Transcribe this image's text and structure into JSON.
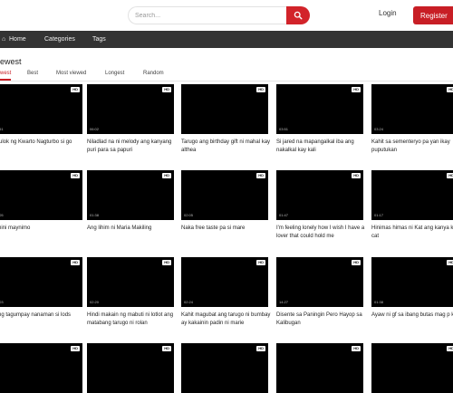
{
  "header": {
    "search_placeholder": "Search...",
    "login_label": "Login",
    "register_label": "Register"
  },
  "nav": {
    "home": "Home",
    "categories": "Categories",
    "tags": "Tags"
  },
  "section": {
    "title": "ewest",
    "tabs": [
      "west",
      "Best",
      "Most viewed",
      "Longest",
      "Random"
    ]
  },
  "colors": {
    "accent": "#c81e25",
    "nav_bg": "#333333",
    "thumb_bg": "#000000"
  },
  "videos": [
    {
      "title": "Sulok ng Kwarto Nagturbo si\ngo",
      "duration": ":51",
      "badge": "HD"
    },
    {
      "title": "Niladlad na ni melody ang kanyang puri para sa papuri",
      "duration": "06:02",
      "badge": "HD"
    },
    {
      "title": "Tarugo ang birthday gift ni mahal kay althea",
      "duration": "",
      "badge": "HD"
    },
    {
      "title": "Si jared na mapangalkal iba ang nakalkal kay kali",
      "duration": "03:51",
      "badge": "HD"
    },
    {
      "title": "Kahit sa sementeryo pa yan ikay puputukan",
      "duration": "03:24",
      "badge": "HD"
    },
    {
      "title": "imini maynimo",
      "duration": ":05",
      "badge": "HD"
    },
    {
      "title": "Ang lihim ni Maria Makiling",
      "duration": "01:38",
      "badge": "HD"
    },
    {
      "title": "Naka free taste pa si mare",
      "duration": "02:05",
      "badge": "HD"
    },
    {
      "title": "I'm feeling lonely how I wish I have a lover that could hold me",
      "duration": "01:47",
      "badge": "HD"
    },
    {
      "title": "Hinimas himas ni Kat ang kanya kitty cat",
      "duration": "01:17",
      "badge": "HD"
    },
    {
      "title": "ting tagumpay nanaman si lods",
      "duration": ":03",
      "badge": "HD"
    },
    {
      "title": "Hindi makain ng mabuti ni lotlot ang matabang tarugo ni rolan",
      "duration": "02:20",
      "badge": "HD"
    },
    {
      "title": "Kahit magubat ang tarugo ni bumbay ay kakainin padin ni marie",
      "duration": "02:24",
      "badge": "HD"
    },
    {
      "title": "Disente sa Paningin Pero Hayop sa Kalibugan",
      "duration": "14:27",
      "badge": "HD"
    },
    {
      "title": "Ayaw ni gf sa ibang butas mag p kayat",
      "duration": "01:38",
      "badge": "HD"
    },
    {
      "title": "",
      "duration": "",
      "badge": "HD"
    },
    {
      "title": "",
      "duration": "",
      "badge": "HD"
    },
    {
      "title": "",
      "duration": "",
      "badge": "HD"
    },
    {
      "title": "",
      "duration": "",
      "badge": "HD"
    },
    {
      "title": "",
      "duration": "",
      "badge": "HD"
    }
  ]
}
